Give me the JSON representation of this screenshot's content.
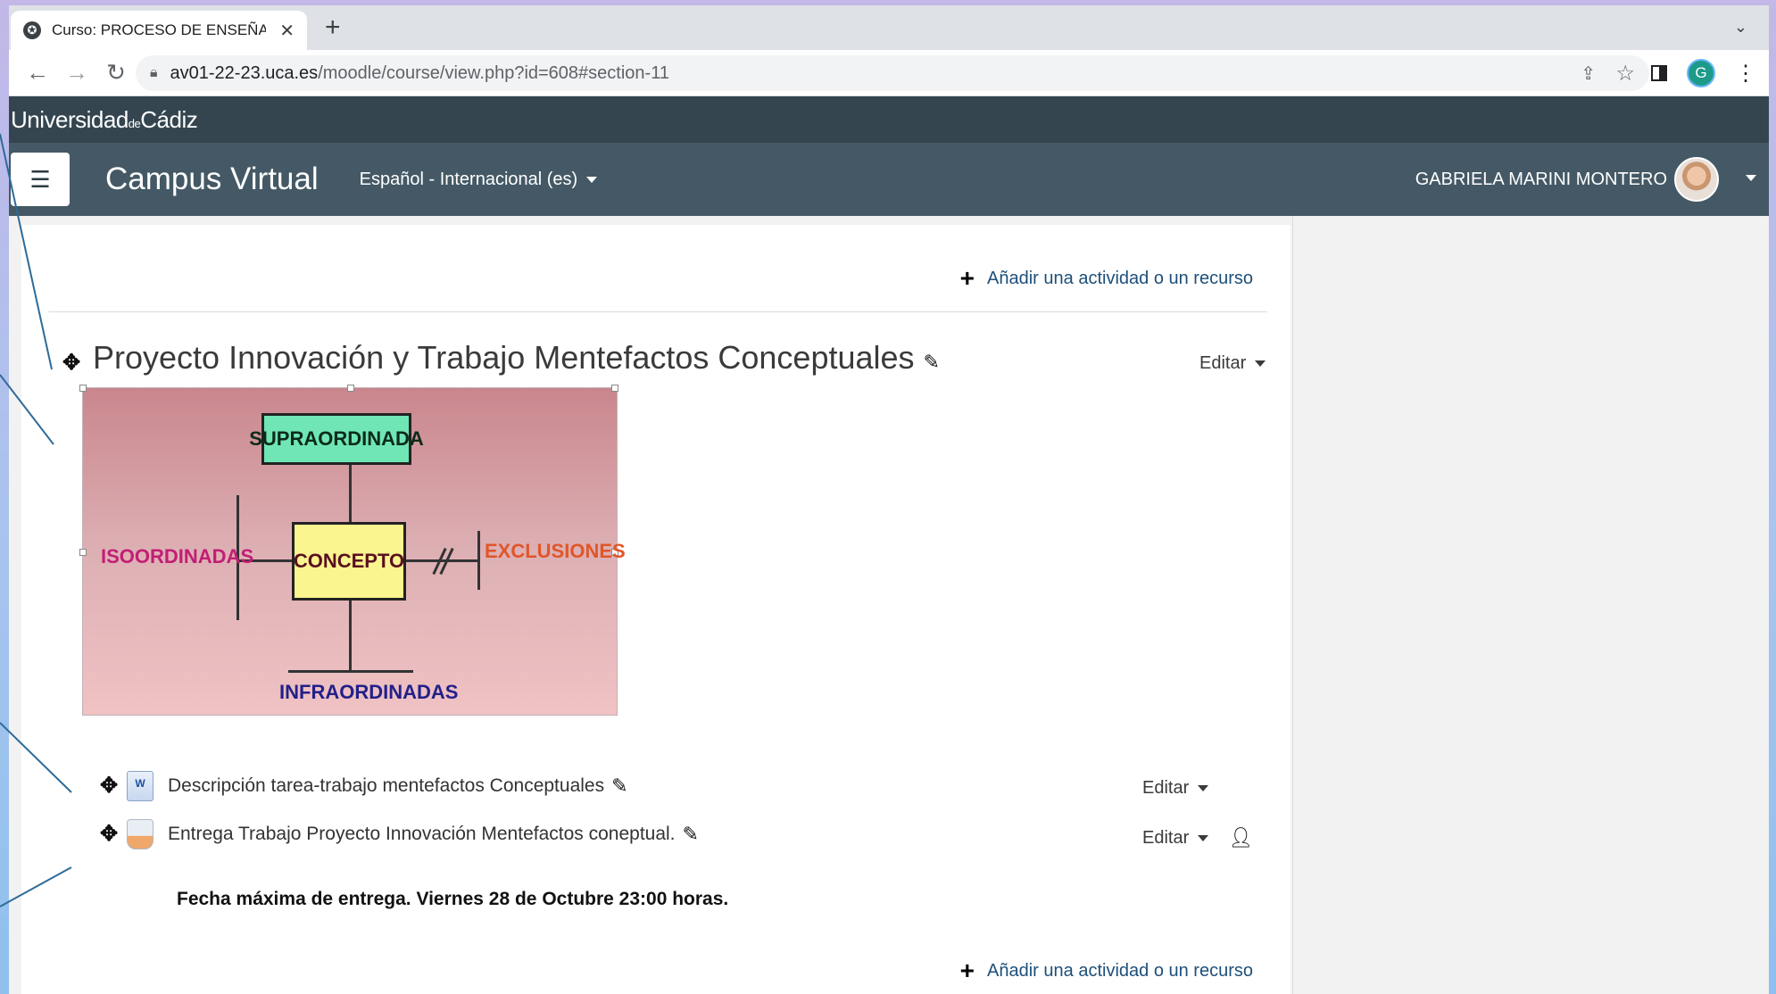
{
  "browser": {
    "tab_title": "Curso: PROCESO DE ENSEÑANZA",
    "url_host": "av01-22-23.uca.es",
    "url_path": "/moodle/course/view.php?id=608#section-11",
    "profile_initial": "G"
  },
  "site": {
    "brand_main": "Universidad",
    "brand_de": "de",
    "brand_city": "Cádiz",
    "name": "Campus Virtual",
    "language": "Español - Internacional (es)",
    "user_name": "GABRIELA MARINI MONTERO"
  },
  "section": {
    "add_activity_top": "Añadir una actividad o un recurso",
    "title": "Proyecto Innovación y Trabajo Mentefactos Conceptuales",
    "edit_label": "Editar",
    "diagram": {
      "supra": "SUPRAORDINADA",
      "concept": "CONCEPTO",
      "iso": "ISOORDINADAS",
      "exclusions": "EXCLUSIONES",
      "infra": "INFRAORDINADAS"
    },
    "activities": [
      {
        "name": "Descripción tarea-trabajo mentefactos Conceptuales",
        "edit_label": "Editar",
        "icon": "word-document-icon"
      },
      {
        "name": "Entrega Trabajo Proyecto Innovación Mentefactos coneptual.",
        "edit_label": "Editar",
        "icon": "assignment-icon"
      }
    ],
    "deadline": "Fecha máxima de entrega. Viernes 28 de Octubre 23:00 horas.",
    "add_activity_bottom": "Añadir una actividad o un recurso"
  },
  "colors": {
    "uca_band": "#34454f",
    "navbar": "#445965",
    "link": "#1d4f7a"
  }
}
